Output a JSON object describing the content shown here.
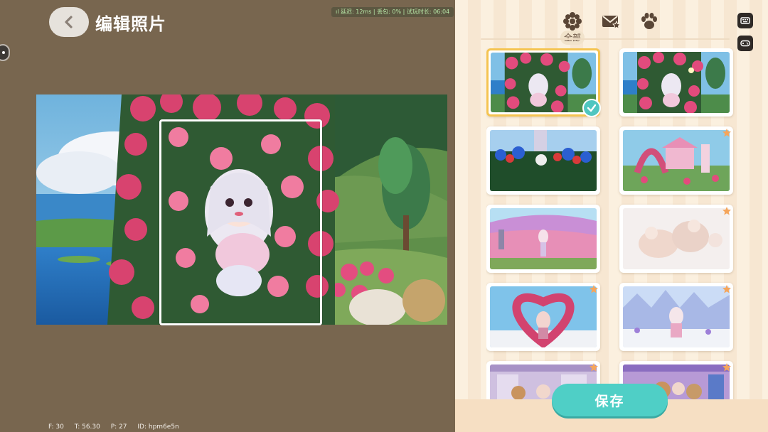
{
  "header": {
    "title": "编辑照片",
    "back_icon": "chevron-left-icon",
    "netstats": "ıl 延迟: 12ms | 丢包: 0% | 试玩时长: 06:04"
  },
  "debug": {
    "fps": "F: 30",
    "time": "T: 56.30",
    "p": "P: 27",
    "id": "ID: hpm6e5n"
  },
  "filters": {
    "items": [
      {
        "icon": "flower-icon",
        "label": "全部",
        "active": true
      },
      {
        "icon": "envelope-star-icon",
        "label": "",
        "active": false
      },
      {
        "icon": "paw-icon",
        "label": "",
        "active": false
      }
    ]
  },
  "side_buttons": [
    {
      "icon": "keyboard-icon"
    },
    {
      "icon": "gamepad-icon"
    }
  ],
  "gallery": {
    "photos": [
      {
        "scene": "rose-arch-girl",
        "selected": true,
        "starred": false
      },
      {
        "scene": "rose-arch-girl",
        "selected": false,
        "starred": false
      },
      {
        "scene": "blue-flower-field",
        "selected": false,
        "starred": false
      },
      {
        "scene": "pink-gazebo",
        "selected": false,
        "starred": true
      },
      {
        "scene": "lavender-field",
        "selected": false,
        "starred": false
      },
      {
        "scene": "white-bears",
        "selected": false,
        "starred": true
      },
      {
        "scene": "heart-arch",
        "selected": false,
        "starred": true
      },
      {
        "scene": "snow-girl",
        "selected": false,
        "starred": true
      },
      {
        "scene": "bear-shop",
        "selected": false,
        "starred": true
      },
      {
        "scene": "bear-shop-2",
        "selected": false,
        "starred": true
      }
    ]
  },
  "actions": {
    "save_label": "保存"
  },
  "colors": {
    "accent_teal": "#4fcfc6",
    "select_gold": "#f5c451",
    "star_orange": "#f5a55b",
    "editor_bg": "#78664f"
  }
}
